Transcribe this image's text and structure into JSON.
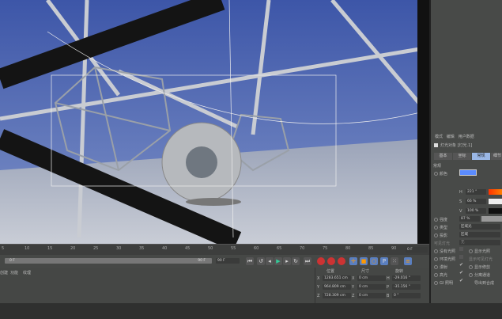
{
  "attributes": {
    "menu": [
      "模式",
      "编辑",
      "用户数据"
    ],
    "object_title": "灯光对象 [灯光.1]",
    "tabs": [
      "基本",
      "坐标",
      "常规",
      "细节"
    ],
    "active_tab": "常规",
    "section": "常规",
    "color_label": "颜色",
    "color_value": "#5b8cff",
    "h_label": "H",
    "h_value": "221 °",
    "s_label": "S",
    "s_value": "66 %",
    "v_label": "V",
    "v_value": "100 %",
    "intensity_label": "强度",
    "intensity_value": "87 %",
    "intensity_percent": 87,
    "type_label": "类型",
    "type_value": "区域光",
    "shadow_label": "投影",
    "shadow_value": "区域",
    "visible_light_label": "可见灯光",
    "visible_light_value": "无",
    "checks": [
      {
        "label": "没有光照",
        "checked": false
      },
      {
        "label": "环境光照",
        "checked": false
      },
      {
        "label": "漫射",
        "checked": true
      },
      {
        "label": "高光",
        "checked": true
      },
      {
        "label": "GI 照明",
        "checked": true
      }
    ],
    "checks_right": [
      "显示光照",
      "显示可见灯光",
      "显示修剪",
      "分离通道",
      "导出到合成"
    ]
  },
  "timeline": {
    "ticks": [
      "5",
      "10",
      "15",
      "20",
      "25",
      "30",
      "35",
      "40",
      "45",
      "50",
      "55",
      "60",
      "65",
      "70",
      "75",
      "80",
      "85",
      "90"
    ],
    "current_frame": "0 F",
    "range_start": "0 F",
    "range_end": "90 F",
    "end_frame": "90 F"
  },
  "material_menu": [
    "创建",
    "功能",
    "纹理"
  ],
  "coords": {
    "headers": [
      "位置",
      "尺寸",
      "旋转"
    ],
    "position": [
      {
        "axis": "X",
        "value": "1283.651 cm"
      },
      {
        "axis": "Y",
        "value": "964.809 cm"
      },
      {
        "axis": "Z",
        "value": "728.309 cm"
      }
    ],
    "size": [
      {
        "axis": "X",
        "value": "0 cm"
      },
      {
        "axis": "Y",
        "value": "0 cm"
      },
      {
        "axis": "Z",
        "value": "0 cm"
      }
    ],
    "rotation": [
      {
        "axis": "H",
        "value": "-29.016 °"
      },
      {
        "axis": "P",
        "value": "-35.156 °"
      },
      {
        "axis": "B",
        "value": "0 °"
      }
    ]
  }
}
